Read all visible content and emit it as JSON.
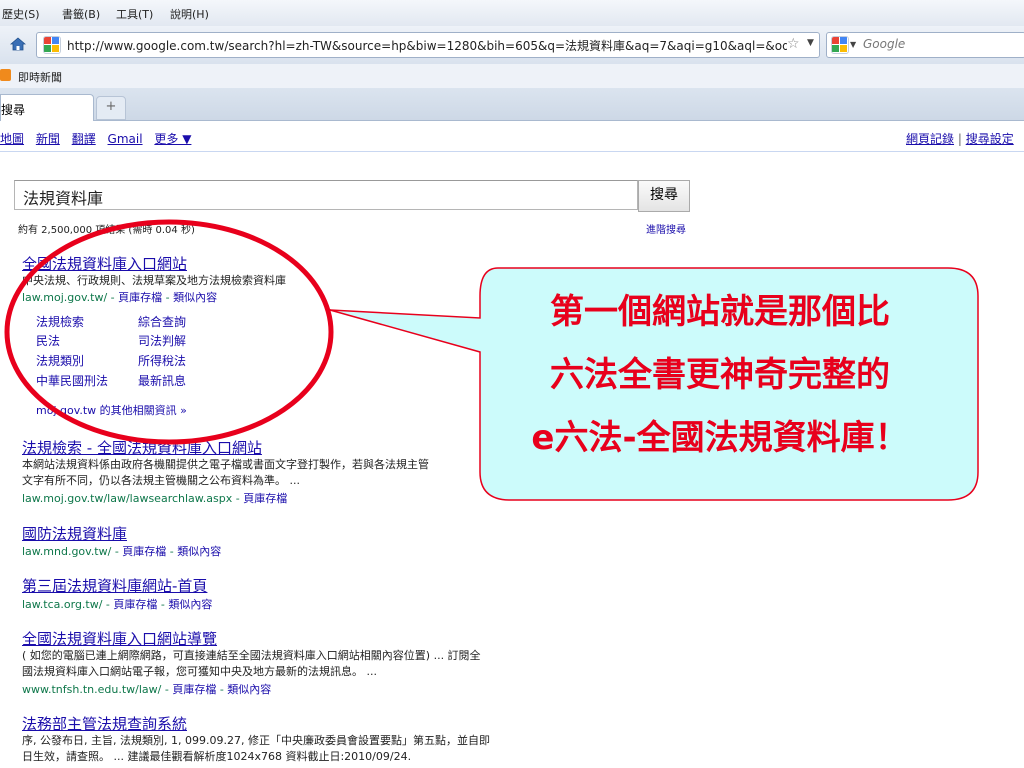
{
  "browser": {
    "menus": [
      "歷史(S)",
      "書籤(B)",
      "工具(T)",
      "說明(H)"
    ],
    "url": "http://www.google.com.tw/search?hl=zh-TW&source=hp&biw=1280&bih=605&q=法規資料庫&aq=7&aqi=g10&aql=&oq=法&gs",
    "search_placeholder": "Google",
    "bookmark": "即時新聞",
    "tab_label": "搜尋",
    "new_tab": "+"
  },
  "google": {
    "top_links": [
      "地圖",
      "新聞",
      "翻譯",
      "Gmail",
      "更多 ▼"
    ],
    "top_right": [
      "網頁記錄",
      "搜尋設定"
    ],
    "query": "法規資料庫",
    "search_button": "搜尋",
    "stats": "約有 2,500,000 項結果 (需時 0.04 秒)",
    "advanced": "進階搜尋"
  },
  "results": [
    {
      "title": "全國法規資料庫入口網站",
      "snippet": "中央法規、行政規則、法規草案及地方法規檢索資料庫",
      "url": "law.moj.gov.tw/",
      "cache": "頁庫存檔",
      "similar": "類似內容",
      "sitelinks": [
        "法規檢索",
        "綜合查詢",
        "民法",
        "司法判解",
        "法規類別",
        "所得稅法",
        "中華民國刑法",
        "最新訊息"
      ],
      "more": "moj.gov.tw 的其他相關資訊 »"
    },
    {
      "title": "法規檢索 - 全國法規資料庫入口網站",
      "snippet1": "本網站法規資料係由政府各機關提供之電子檔或書面文字登打製作，若與各法規主管",
      "snippet2": "文字有所不同，仍以各法規主管機關之公布資料為準。 ...",
      "url": "law.moj.gov.tw/law/lawsearchlaw.aspx",
      "cache": "頁庫存檔"
    },
    {
      "title": "國防法規資料庫",
      "url": "law.mnd.gov.tw/",
      "cache": "頁庫存檔",
      "similar": "類似內容"
    },
    {
      "title": "第三屆法規資料庫網站-首頁",
      "url": "law.tca.org.tw/",
      "cache": "頁庫存檔",
      "similar": "類似內容"
    },
    {
      "title": "全國法規資料庫入口網站導覽",
      "snippet1": "( 如您的電腦已連上網際網路，可直接連結至全國法規資料庫入口網站相關內容位置) ... 訂閱全",
      "snippet2": "國法規資料庫入口網站電子報，您可獲知中央及地方最新的法規訊息。 ...",
      "url": "www.tnfsh.tn.edu.tw/law/",
      "cache": "頁庫存檔",
      "similar": "類似內容"
    },
    {
      "title": "法務部主管法規查詢系統",
      "snippet1": "序, 公發布日, 主旨, 法規類別, 1, 099.09.27, 修正「中央廉政委員會設置要點」第五點，並自即",
      "snippet2": "日生效，請查照。 ... 建議最佳觀看解析度1024x768 資料截止日:2010/09/24."
    }
  ],
  "annotation": {
    "lines": [
      "第一個網站就是那個比",
      "六法全書更神奇完整的",
      "e六法-全國法規資料庫！"
    ],
    "text_color": "#e8001c",
    "bubble_fill": "#ccfbfb",
    "bubble_stroke": "#e8001c",
    "ellipse_stroke": "#e8001c"
  }
}
